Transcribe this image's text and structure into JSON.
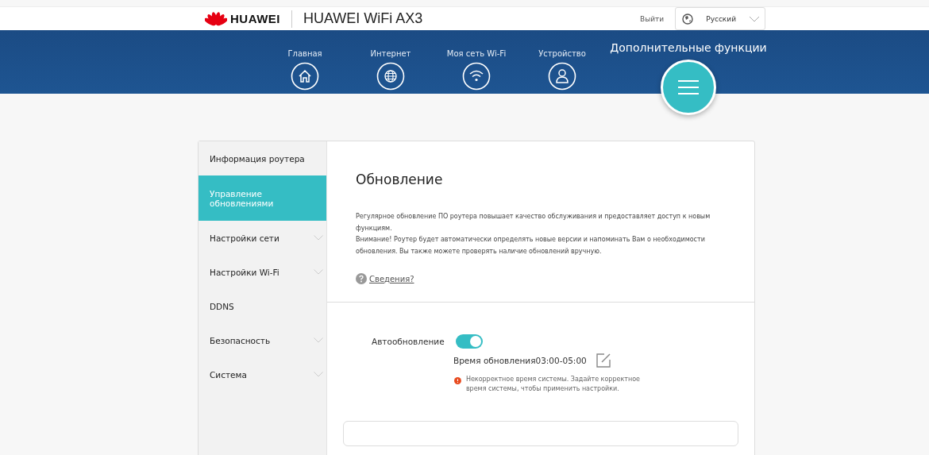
{
  "header": {
    "brand": "HUAWEI",
    "product": "HUAWEI WiFi AX3",
    "logout": "Выйти",
    "language": "Русский"
  },
  "nav": [
    {
      "label": "Главная",
      "selected": false
    },
    {
      "label": "Интернет",
      "selected": false
    },
    {
      "label": "Моя сеть Wi-Fi",
      "selected": false
    },
    {
      "label": "Устройство",
      "selected": false
    },
    {
      "label": "Дополнительные функции",
      "selected": true
    }
  ],
  "sidebar": {
    "items": [
      {
        "label": "Информация роутера",
        "selected": false,
        "expandable": false
      },
      {
        "label": "Управление обновлениями",
        "selected": true,
        "expandable": false
      },
      {
        "label": "Настройки сети",
        "selected": false,
        "expandable": true
      },
      {
        "label": "Настройки Wi-Fi",
        "selected": false,
        "expandable": true
      },
      {
        "label": "DDNS",
        "selected": false,
        "expandable": false
      },
      {
        "label": "Безопасность",
        "selected": false,
        "expandable": true
      },
      {
        "label": "Система",
        "selected": false,
        "expandable": true
      }
    ]
  },
  "content": {
    "title": "Обновление",
    "description": [
      "Регулярное обновление ПО роутера повышает качество обслуживания и предоставляет доступ к новым функциям.",
      "Внимание! Роутер будет автоматически определять новые версии и напоминать Вам о необходимости обновления. Вы также можете проверять наличие обновлений вручную."
    ],
    "details_link": "Сведения?",
    "auto_update": {
      "label": "Автообновление",
      "on": true,
      "time": "Время обновления03:00-05:00",
      "warning": "Некорректное время системы. Задайте корректное время системы, чтобы применить настройки."
    }
  }
}
